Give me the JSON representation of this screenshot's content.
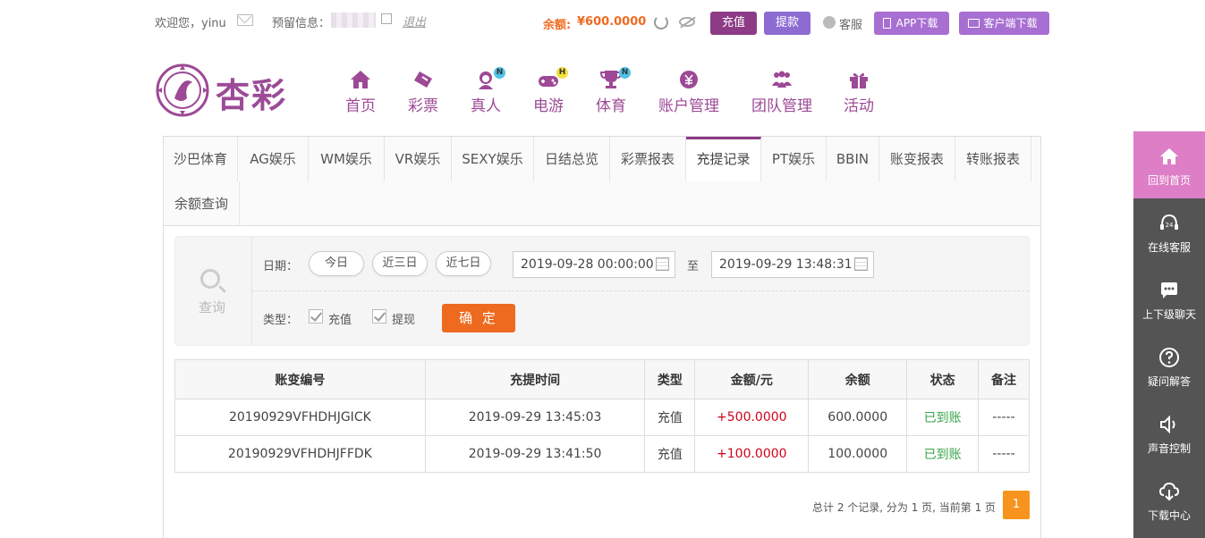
{
  "topbar": {
    "welcome": "欢迎您，yinu",
    "reserved_label": "预留信息：",
    "logout": "退出",
    "balance_label": "余额:",
    "balance_value": "¥600.0000",
    "recharge": "充值",
    "withdraw": "提款",
    "customer_service": "客服",
    "app_download": "APP下载",
    "client_download": "客户端下载"
  },
  "brand": {
    "logo_text": "杏彩",
    "color": "#9d4996"
  },
  "nav": [
    {
      "label": "首页",
      "icon": "home-icon"
    },
    {
      "label": "彩票",
      "icon": "ticket-icon"
    },
    {
      "label": "真人",
      "icon": "live-dealer-icon",
      "badge": "N"
    },
    {
      "label": "电游",
      "icon": "gamepad-icon",
      "badge": "H"
    },
    {
      "label": "体育",
      "icon": "trophy-icon",
      "badge": "N"
    },
    {
      "label": "账户管理",
      "icon": "yuan-icon"
    },
    {
      "label": "团队管理",
      "icon": "team-icon"
    },
    {
      "label": "活动",
      "icon": "gift-icon"
    }
  ],
  "tabs": [
    "沙巴体育",
    "AG娱乐",
    "WM娱乐",
    "VR娱乐",
    "SEXY娱乐",
    "日结总览",
    "彩票报表",
    "充提记录",
    "PT娱乐",
    "BBIN",
    "账变报表",
    "转账报表",
    "余额查询"
  ],
  "active_tab": "充提记录",
  "query": {
    "title": "查询",
    "date_label": "日期：",
    "today": "今日",
    "three_days": "近三日",
    "seven_days": "近七日",
    "start": "2019-09-28 00:00:00",
    "to": "至",
    "end": "2019-09-29 13:48:31",
    "type_label": "类型：",
    "type_recharge": "充值",
    "type_withdraw": "提现",
    "confirm": "确 定"
  },
  "table": {
    "headers": [
      "账变编号",
      "充提时间",
      "类型",
      "金额/元",
      "余额",
      "状态",
      "备注"
    ],
    "rows": [
      [
        "20190929VFHDHJGICK",
        "2019-09-29 13:45:03",
        "充值",
        "+500.0000",
        "600.0000",
        "已到账",
        "-----"
      ],
      [
        "20190929VFHDHJFFDK",
        "2019-09-29 13:41:50",
        "充值",
        "+100.0000",
        "100.0000",
        "已到账",
        "-----"
      ]
    ]
  },
  "pager": {
    "info": "总计 2 个记录, 分为 1 页, 当前第 1 页",
    "page": "1"
  },
  "side": [
    {
      "label": "回到首页",
      "icon": "home-icon"
    },
    {
      "label": "在线客服",
      "icon": "headset-24-icon"
    },
    {
      "label": "上下级聊天",
      "icon": "chat-icon"
    },
    {
      "label": "疑问解答",
      "icon": "question-icon"
    },
    {
      "label": "声音控制",
      "icon": "speaker-icon"
    },
    {
      "label": "下载中心",
      "icon": "cloud-download-icon"
    }
  ]
}
